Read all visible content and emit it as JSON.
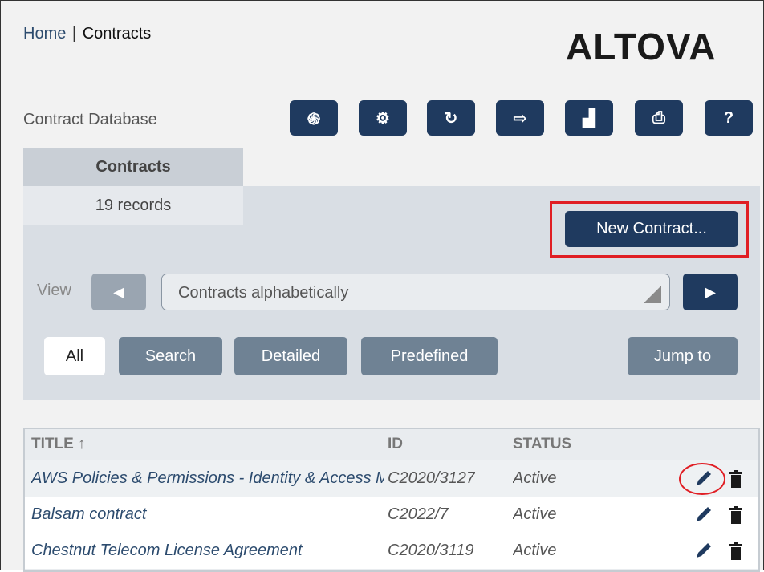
{
  "breadcrumb": {
    "home": "Home",
    "separator": "|",
    "current": "Contracts"
  },
  "brand": {
    "logo_text": "ALTOVA",
    "accent": "#d0202a"
  },
  "app": {
    "db_label": "Contract Database"
  },
  "toolbar": {
    "buttons": [
      {
        "icon": "fingerprint-icon",
        "glyph": "֍"
      },
      {
        "icon": "gear-icon",
        "glyph": "⚙"
      },
      {
        "icon": "refresh-icon",
        "glyph": "↻"
      },
      {
        "icon": "logout-icon",
        "glyph": "⇨"
      },
      {
        "icon": "bar-chart-icon",
        "glyph": "▟"
      },
      {
        "icon": "print-icon",
        "glyph": "⎙"
      },
      {
        "icon": "help-icon",
        "glyph": "?"
      }
    ]
  },
  "tab": {
    "label": "Contracts",
    "records": "19 records"
  },
  "actions": {
    "new_contract": "New Contract..."
  },
  "view": {
    "label": "View",
    "selected": "Contracts alphabetically",
    "prev_glyph": "◀",
    "next_glyph": "▶"
  },
  "filters": {
    "all": "All",
    "search": "Search",
    "detailed": "Detailed",
    "predefined": "Predefined",
    "jump_to": "Jump to"
  },
  "table": {
    "headers": {
      "title": "TITLE ↑",
      "id": "ID",
      "status": "STATUS"
    },
    "rows": [
      {
        "title": "AWS Policies & Permissions - Identity & Access Management",
        "id": "C2020/3127",
        "status": "Active"
      },
      {
        "title": "Balsam contract",
        "id": "C2022/7",
        "status": "Active"
      },
      {
        "title": "Chestnut Telecom License Agreement",
        "id": "C2020/3119",
        "status": "Active"
      }
    ]
  },
  "colors": {
    "primary": "#1f3a5f",
    "secondary": "#6f8294",
    "highlight": "#e01e24"
  }
}
